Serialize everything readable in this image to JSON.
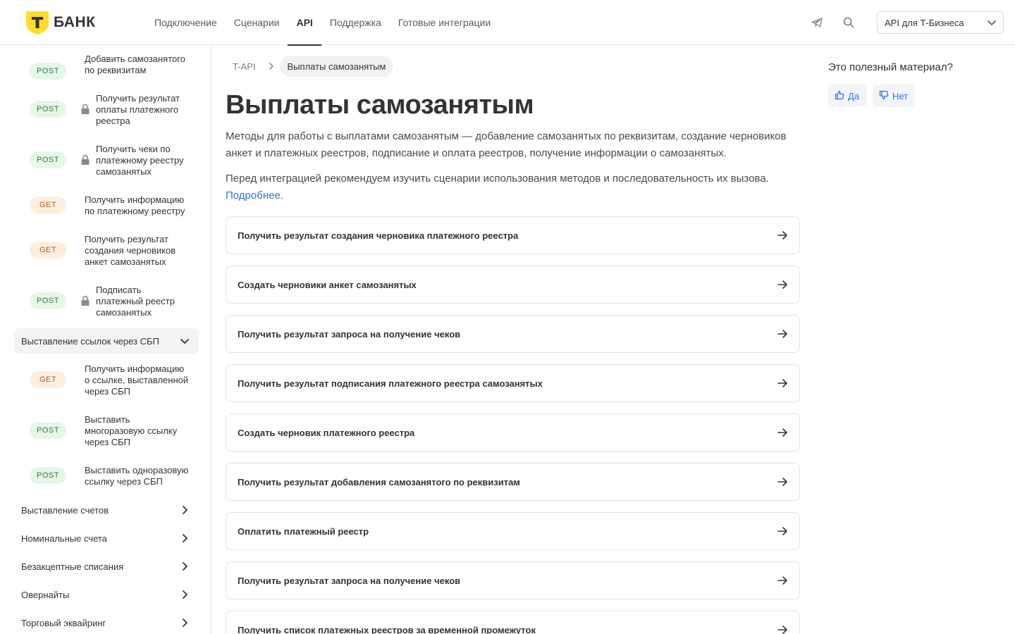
{
  "header": {
    "logo_letter": "Т",
    "logo_text": "БАНК",
    "nav": [
      "Подключение",
      "Сценарии",
      "API",
      "Поддержка",
      "Готовые интеграции"
    ],
    "active_nav": "API",
    "product_select": "API для Т-Бизнеса"
  },
  "sidebar": {
    "methods_top": [
      {
        "method": "POST",
        "label_lines": [
          "Добавить самозанятого",
          "по реквизитам"
        ],
        "locked": false
      },
      {
        "method": "POST",
        "label_lines": [
          "Получить результат",
          "оплаты платежного",
          "реестра"
        ],
        "locked": true
      },
      {
        "method": "POST",
        "label_lines": [
          "Получить чеки по",
          "платежному реестру",
          "самозанятых"
        ],
        "locked": true
      },
      {
        "method": "GET",
        "label_lines": [
          "Получить информацию",
          "по платежному реестру"
        ],
        "locked": false
      },
      {
        "method": "GET",
        "label_lines": [
          "Получить результат",
          "создания черновиков",
          "анкет самозанятых"
        ],
        "locked": false
      },
      {
        "method": "POST",
        "label_lines": [
          "Подписать",
          "платежный реестр",
          "самозанятых"
        ],
        "locked": true
      }
    ],
    "open_group": "Выставление ссылок через СБП",
    "methods_sbp": [
      {
        "method": "GET",
        "label_lines": [
          "Получить информацию",
          "о ссылке, выставленной",
          "через СБП"
        ],
        "locked": false
      },
      {
        "method": "POST",
        "label_lines": [
          "Выставить",
          "многоразовую ссылку",
          "через СБП"
        ],
        "locked": false
      },
      {
        "method": "POST",
        "label_lines": [
          "Выставить одноразовую",
          "ссылку через СБП"
        ],
        "locked": false
      }
    ],
    "groups": [
      "Выставление счетов",
      "Номинальные счета",
      "Безакцептные списания",
      "Овернайты",
      "Торговый эквайринг"
    ]
  },
  "main": {
    "breadcrumb_root": "T-API",
    "breadcrumb_current": "Выплаты самозанятым",
    "title": "Выплаты самозанятым",
    "desc_line1": "Методы для работы с выплатами самозанятым — добавление самозанятых по реквизитам, создание черновиков",
    "desc_line2": "анкет и платежных реестров, подписание и оплата реестров, получение информации о самозанятых.",
    "desc2_line1": "Перед интеграцией рекомендуем изучить сценарии использования методов и последовательность их вызова.",
    "desc2_link": "Подробнее",
    "desc2_tail": ".",
    "cards": [
      "Получить результат создания черновика платежного реестра",
      "Создать черновики анкет самозанятых",
      "Получить результат запроса на получение чеков",
      "Получить результат подписания платежного реестра самозанятых",
      "Создать черновик платежного реестра",
      "Получить результат добавления самозанятого по реквизитам",
      "Оплатить платежный реестр",
      "Получить результат запроса на получение чеков",
      "Получить список платежных реестров за временной промежуток"
    ]
  },
  "feedback": {
    "title": "Это полезный материал?",
    "yes": "Да",
    "no": "Нет"
  },
  "colors": {
    "brand_yellow": "#FFDD2D",
    "link_blue": "#336FEE",
    "post_badge_bg": "#E6F6E8",
    "get_badge_bg": "#FDEEDD"
  }
}
